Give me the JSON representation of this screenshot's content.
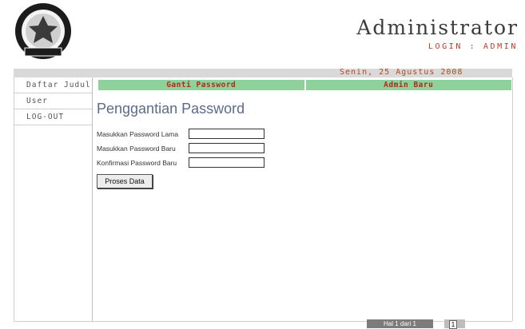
{
  "header": {
    "title": "Administrator",
    "subtitle": "LOGIN : ADMIN",
    "logo_text_top": "UNIVERSITAS DIPONEGORO",
    "logo_text_bottom": "SEMARANG"
  },
  "date": "Senin, 25 Agustus 2008",
  "sidebar": {
    "items": [
      {
        "label": "Daftar Judul"
      },
      {
        "label": "User"
      },
      {
        "label": "LOG-OUT"
      }
    ]
  },
  "tabs": [
    {
      "label": "Ganti Password"
    },
    {
      "label": "Admin Baru"
    }
  ],
  "main": {
    "page_title": "Penggantian Password",
    "fields": [
      {
        "label": "Masukkan Password Lama",
        "value": ""
      },
      {
        "label": "Masukkan Password Baru",
        "value": ""
      },
      {
        "label": "Konfirmasi Password Baru",
        "value": ""
      }
    ],
    "submit_label": "Proses Data"
  },
  "pager": {
    "text": "Hal 1 dari 1",
    "page": "1"
  },
  "colors": {
    "tab_bg": "#8fd19a",
    "tab_text": "#b42a1a",
    "accent_red": "#c0392b"
  }
}
